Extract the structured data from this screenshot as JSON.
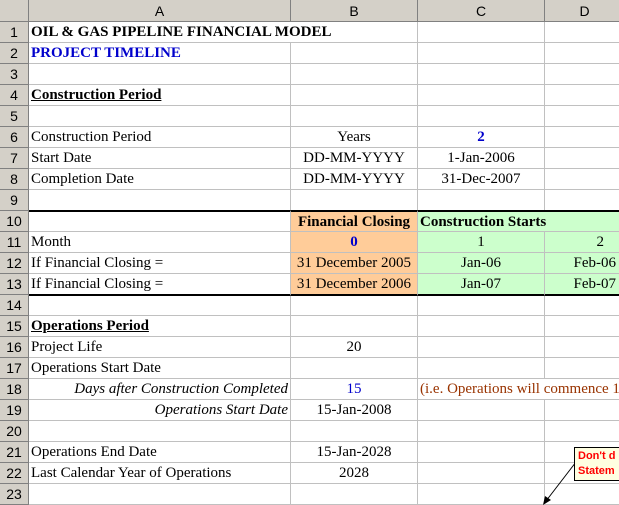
{
  "columns": [
    "A",
    "B",
    "C",
    "D"
  ],
  "rows": [
    "1",
    "2",
    "3",
    "4",
    "5",
    "6",
    "7",
    "8",
    "9",
    "10",
    "11",
    "12",
    "13",
    "14",
    "15",
    "16",
    "17",
    "18",
    "19",
    "20",
    "21",
    "22",
    "23"
  ],
  "cells": {
    "a1": "OIL & GAS PIPELINE FINANCIAL MODEL",
    "a2": "PROJECT TIMELINE",
    "a4": "Construction Period",
    "a6": "Construction Period",
    "b6": "Years",
    "c6": "2",
    "a7": "Start Date",
    "b7": "DD-MM-YYYY",
    "c7": "1-Jan-2006",
    "a8": "Completion Date",
    "b8": "DD-MM-YYYY",
    "c8": "31-Dec-2007",
    "b10": "Financial Closing",
    "c10": "Construction Starts",
    "a11": "Month",
    "b11": "0",
    "c11": "1",
    "d11": "2",
    "a12": "If Financial Closing =",
    "b12": "31 December 2005",
    "c12": "Jan-06",
    "d12": "Feb-06",
    "a13": "If Financial Closing =",
    "b13": "31 December 2006",
    "c13": "Jan-07",
    "d13": "Feb-07",
    "a15": "Operations Period",
    "a16": "Project Life",
    "b16": "20",
    "a17": "Operations Start Date",
    "a18": "Days after Construction Completed",
    "b18": "15",
    "c18": "(i.e. Operations will commence 1",
    "a19": "Operations Start Date",
    "b19": "15-Jan-2008",
    "a21": "Operations End Date",
    "b21": "15-Jan-2028",
    "a22": "Last Calendar Year of Operations",
    "b22": "2028"
  },
  "comment": {
    "line1": "Don't d",
    "line2": "Statem"
  },
  "colors": {
    "header_bg": "#d4d0c8",
    "financial_closing_bg": "#ffcc99",
    "construction_starts_bg": "#ccffcc",
    "input_blue": "#0000cc",
    "note_darkred": "#993300",
    "comment_red": "#ff0000"
  }
}
